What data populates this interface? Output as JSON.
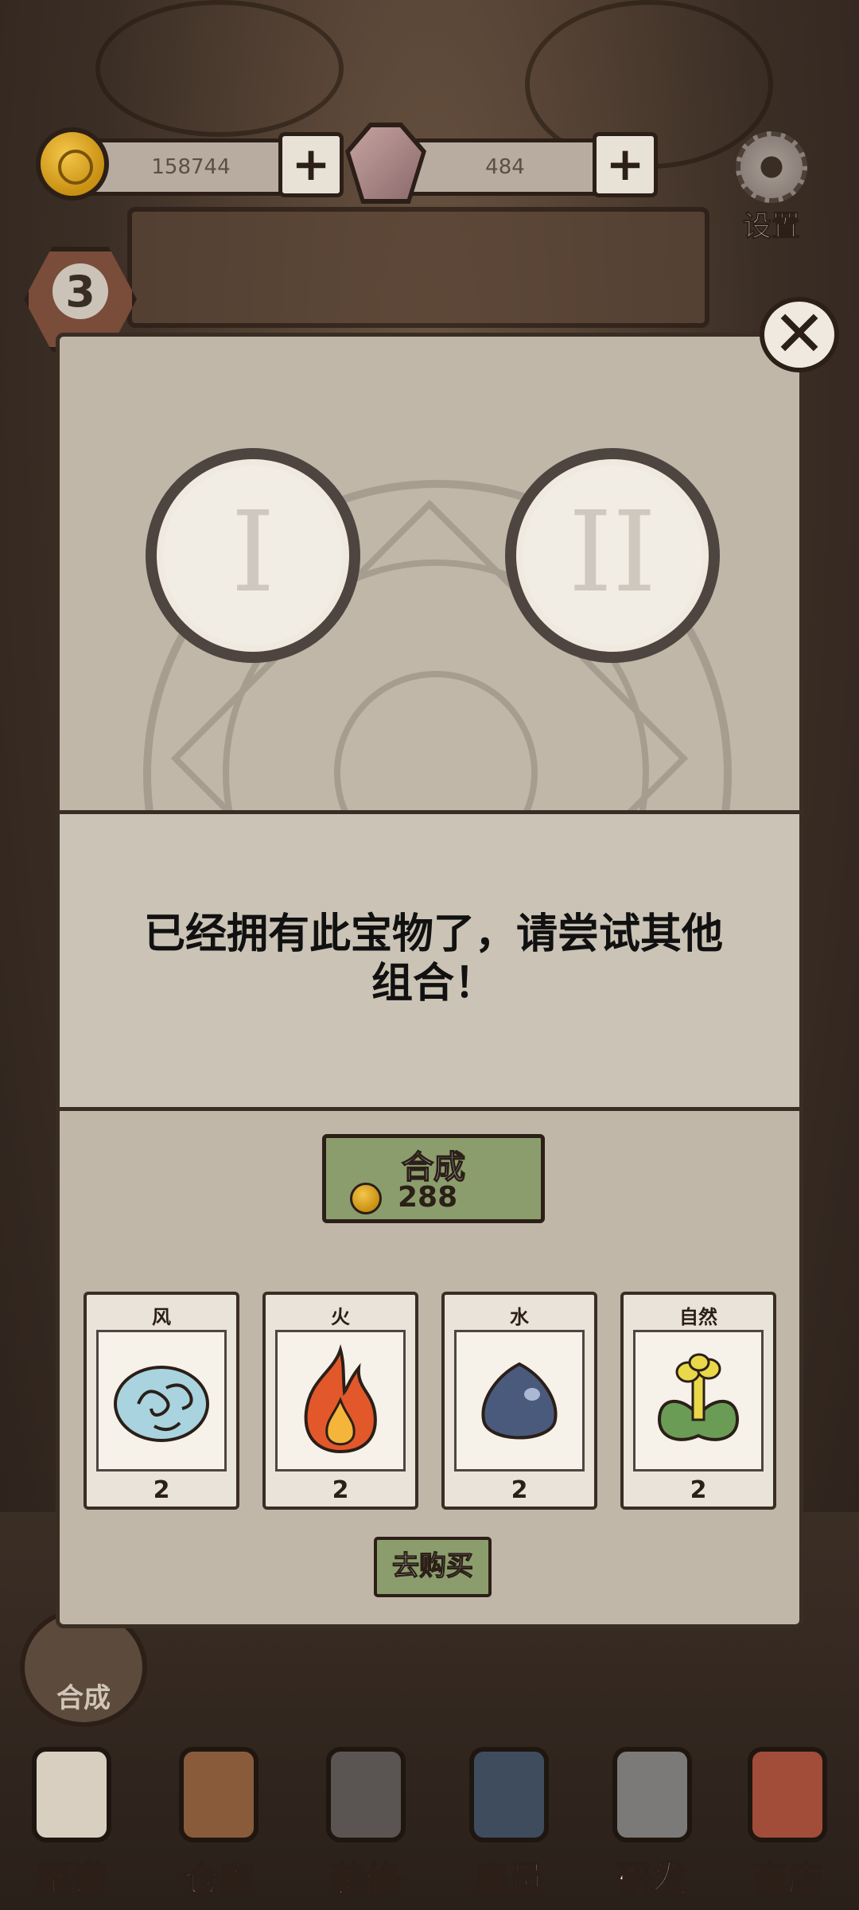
{
  "hud": {
    "coins": "158744",
    "gems": "484",
    "plus_label": "+",
    "settings_label": "设置",
    "level": "3"
  },
  "panel": {
    "close_label": "✕",
    "slot1_numeral": "I",
    "slot2_numeral": "II",
    "message": "已经拥有此宝物了，请尝试其他组合！",
    "combine": {
      "label": "合成",
      "cost": "288"
    },
    "materials": [
      {
        "name": "风",
        "count": "2",
        "icon": "wind-icon",
        "color": "#a9d3df"
      },
      {
        "name": "火",
        "count": "2",
        "icon": "fire-icon",
        "color": "#e2582b"
      },
      {
        "name": "水",
        "count": "2",
        "icon": "water-drop-icon",
        "color": "#4a5a7c"
      },
      {
        "name": "自然",
        "count": "2",
        "icon": "nature-plant-icon",
        "color": "#6a9c56"
      }
    ],
    "buy_label": "去购买"
  },
  "side": {
    "combine_label": "合成"
  },
  "nav": [
    {
      "label": "菜谱",
      "icon": "recipe-scroll-icon"
    },
    {
      "label": "仓库",
      "icon": "storage-cabinet-icon"
    },
    {
      "label": "装修",
      "icon": "hammer-icon"
    },
    {
      "label": "雇员",
      "icon": "employee-icon"
    },
    {
      "label": "研发",
      "icon": "cooking-pot-icon"
    },
    {
      "label": "商店",
      "icon": "shop-bag-icon"
    }
  ],
  "colors": {
    "panel_bg": "#c0b7a8",
    "button_green": "#8b9d6c",
    "outline": "#2b1f18"
  }
}
